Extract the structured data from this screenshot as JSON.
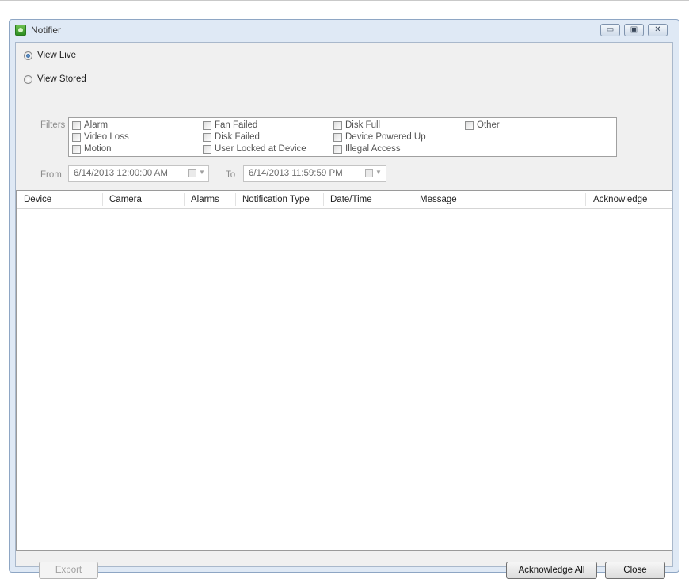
{
  "window": {
    "title": "Notifier"
  },
  "view": {
    "live_label": "View Live",
    "stored_label": "View Stored",
    "selected": "live"
  },
  "filters": {
    "label": "Filters",
    "options": [
      "Alarm",
      "Video Loss",
      "Motion",
      "Fan Failed",
      "Disk Failed",
      "User Locked at Device",
      "Disk Full",
      "Device Powered Up",
      "Illegal Access",
      "Other"
    ]
  },
  "range": {
    "from_label": "From",
    "from_value": "6/14/2013 12:00:00 AM",
    "to_label": "To",
    "to_value": "6/14/2013 11:59:59 PM"
  },
  "table": {
    "columns": [
      "Device",
      "Camera",
      "Alarms",
      "Notification Type",
      "Date/Time",
      "Message",
      "Acknowledge"
    ],
    "rows": []
  },
  "buttons": {
    "export": "Export",
    "acknowledge_all": "Acknowledge All",
    "close": "Close"
  },
  "titlebar_controls": {
    "minimize": "▭",
    "maximize": "▣",
    "close": "✕"
  }
}
